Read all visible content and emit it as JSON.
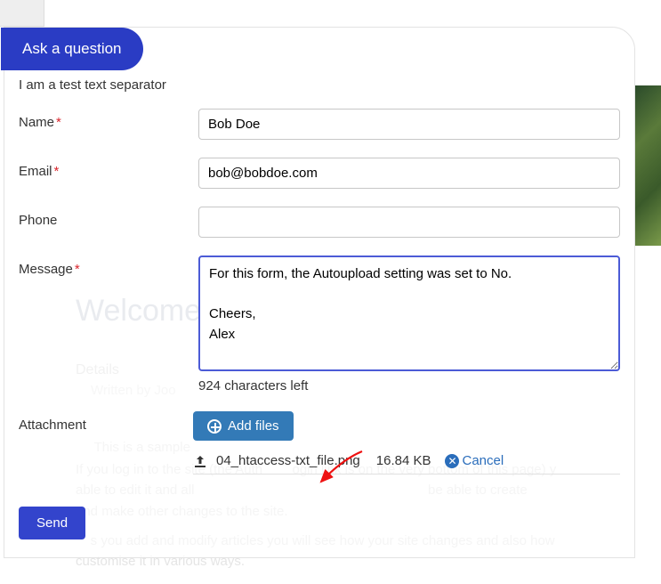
{
  "tab_label": "Ask a question",
  "separator_text": "I am a test text separator",
  "fields": {
    "name": {
      "label": "Name",
      "required": true,
      "value": "Bob Doe"
    },
    "email": {
      "label": "Email",
      "required": true,
      "value": "bob@bobdoe.com"
    },
    "phone": {
      "label": "Phone",
      "required": false,
      "value": ""
    },
    "message": {
      "label": "Message",
      "required": true,
      "value": "For this form, the Autoupload setting was set to No.\n\nCheers,\nAlex",
      "chars_left_text": "924 characters left"
    },
    "attachment": {
      "label": "Attachment",
      "add_files_label": "Add files",
      "file_name": "04_htaccess-txt_file.png",
      "file_size": "16.84 KB",
      "cancel_label": "Cancel"
    }
  },
  "send_label": "Send",
  "background": {
    "welcome": "Welcome",
    "details": "Details",
    "written": "Written by Joo",
    "p1": "     This is a sample",
    "p2": "If you log in to the site (the Auth        ogin link is on the very bottom of this page) y",
    "p3": "able to edit it and all                                                               be able to create",
    "p4": "and make other changes to the site.",
    "p5": "    s you add and modify articles you will see how your site changes and also how",
    "p6": "customise it in various ways."
  }
}
